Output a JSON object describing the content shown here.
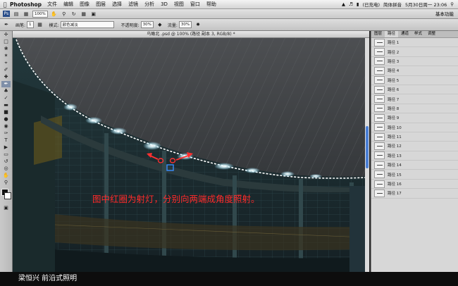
{
  "menubar": {
    "app_name": "Photoshop",
    "menus": [
      "文件",
      "编辑",
      "图像",
      "图层",
      "选择",
      "滤镜",
      "分析",
      "3D",
      "视图",
      "窗口",
      "帮助"
    ],
    "battery": "(已充电)",
    "input_method": "简体拼音",
    "datetime": "5月30日周一  23:06"
  },
  "optbar": {
    "zoom": "100%",
    "workspace": "基本功能"
  },
  "optbar2": {
    "brush_label": "画笔:",
    "brush_size": "1",
    "mode_label": "模式:",
    "mode_value": "颜色减淡",
    "opacity_label": "不透明度:",
    "opacity_value": "30%",
    "flow_label": "流量:",
    "flow_value": "30%"
  },
  "document": {
    "title": "鸟瞰北 .psd @ 100% (路径 副本 3, RGB/8) *"
  },
  "panel": {
    "tabs": [
      "图层",
      "路径",
      "通道",
      "样式",
      "调整"
    ],
    "paths": [
      "路径 1",
      "路径 2",
      "路径 3",
      "路径 4",
      "路径 5",
      "路径 6",
      "路径 7",
      "路径 8",
      "路径 9",
      "路径 10",
      "路径 11",
      "路径 12",
      "路径 13",
      "路径 14",
      "路径 15",
      "路径 16",
      "路径 17"
    ]
  },
  "canvas": {
    "annotation": "图中红圈为射灯，分别向两端成角度照射。"
  },
  "caption": {
    "text": "梁恒兴   前沿式照明"
  },
  "colors": {
    "annotation_red": "#ff2b2b",
    "selection_marquee": "#ffffff",
    "scroll_accent": "#4a7fd6"
  }
}
